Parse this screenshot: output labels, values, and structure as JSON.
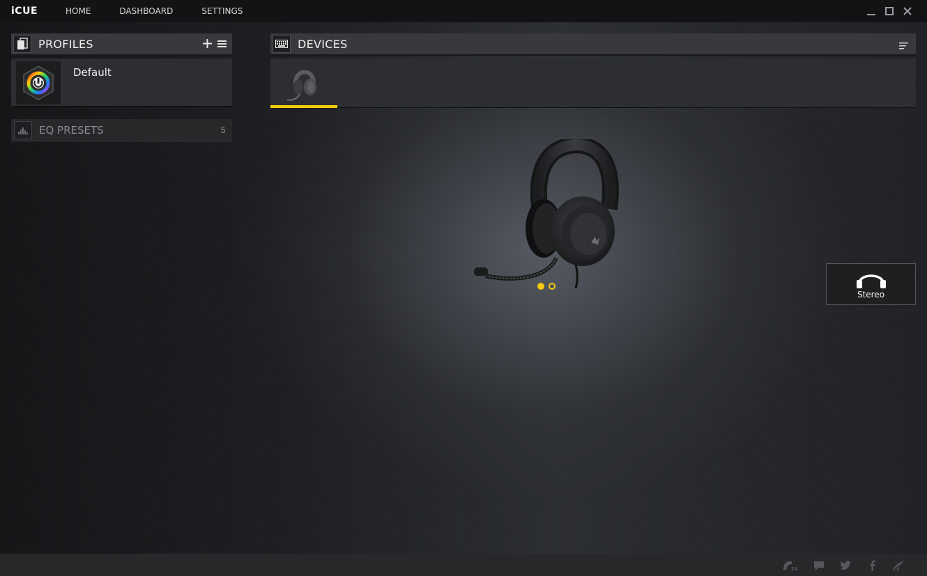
{
  "app": {
    "brand": "iCUE",
    "nav": [
      {
        "label": "HOME"
      },
      {
        "label": "DASHBOARD"
      },
      {
        "label": "SETTINGS"
      }
    ]
  },
  "profiles": {
    "title": "PROFILES",
    "items": [
      {
        "name": "Default"
      }
    ]
  },
  "eq_presets": {
    "title": "EQ PRESETS",
    "count": "5"
  },
  "devices": {
    "title": "DEVICES",
    "selected_index": 0
  },
  "device_view": {
    "page_indicator": {
      "total": 2,
      "current": 1
    }
  },
  "output_mode": {
    "label": "Stereo"
  },
  "footer": {
    "notification_count": "24"
  },
  "colors": {
    "accent": "#f2cc0c",
    "panel_header": "#37393c",
    "topbar": "#121314"
  },
  "icons": {
    "profiles": "profiles-stack-icon",
    "eq": "equalizer-icon",
    "devices": "keyboard-icon",
    "stereo": "headphones-icon",
    "footer": [
      "notification-icon",
      "chat-icon",
      "twitter-icon",
      "facebook-icon",
      "corsair-sails-icon"
    ]
  }
}
